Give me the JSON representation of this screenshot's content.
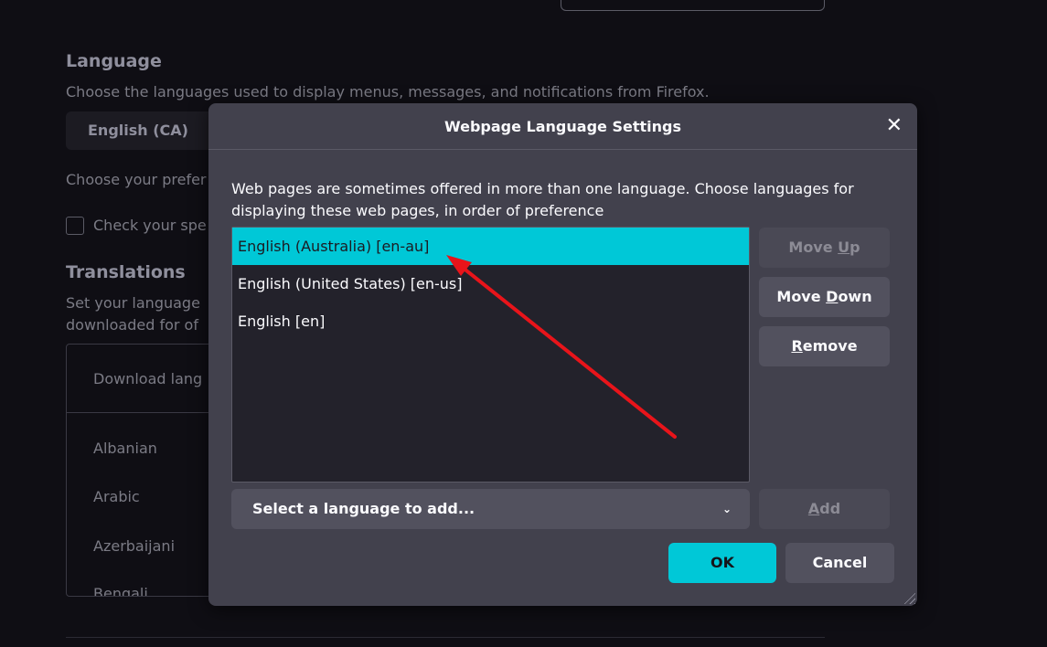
{
  "background": {
    "language_heading": "Language",
    "language_desc": "Choose the languages used to display menus, messages, and notifications from Firefox.",
    "language_select": "English (CA)",
    "preferred_text": "Choose your prefer",
    "spell_check": "Check your spe",
    "translations_heading": "Translations",
    "translations_desc1": "Set your language",
    "translations_desc2": "downloaded for of",
    "download_lang": "Download lang",
    "languages": [
      "Albanian",
      "Arabic",
      "Azerbaijani",
      "Bengali"
    ]
  },
  "dialog": {
    "title": "Webpage Language Settings",
    "description": "Web pages are sometimes offered in more than one language. Choose languages for displaying these web pages, in order of preference",
    "languages": [
      "English (Australia) [en-au]",
      "English (United States) [en-us]",
      "English [en]"
    ],
    "selected_index": 0,
    "move_up": {
      "pre": "Move ",
      "key": "U",
      "post": "p"
    },
    "move_down": {
      "pre": "Move ",
      "key": "D",
      "post": "own"
    },
    "remove": {
      "pre": "",
      "key": "R",
      "post": "emove"
    },
    "add": {
      "pre": "",
      "key": "A",
      "post": "dd"
    },
    "select_placeholder": "Select a language to add...",
    "ok": "OK",
    "cancel": "Cancel"
  },
  "colors": {
    "accent": "#00c8d7",
    "annotation_arrow": "#e8141a"
  }
}
